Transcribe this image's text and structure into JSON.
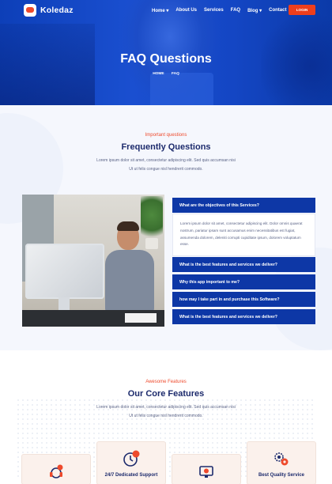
{
  "brand": {
    "name": "Koledaz"
  },
  "nav": {
    "items": [
      {
        "label": "Home",
        "dropdown": true
      },
      {
        "label": "About Us",
        "dropdown": false
      },
      {
        "label": "Services",
        "dropdown": false
      },
      {
        "label": "FAQ",
        "dropdown": false
      },
      {
        "label": "Blog",
        "dropdown": true
      },
      {
        "label": "Contact",
        "dropdown": false
      }
    ],
    "login_label": "LOGIN"
  },
  "hero": {
    "title": "FAQ Questions",
    "breadcrumb": [
      "HOME",
      "FAQ"
    ]
  },
  "faq_section": {
    "eyebrow": "Important questions",
    "title": "Frequently Questions",
    "intro": "Lorem ipsum dolor sit amet, consectetur adipiscing elit. Sed quis accumsan nisi Ut ut felis congue nisl hendrerit commodo.",
    "items": [
      {
        "question": "What are the objectives of this Services?",
        "expanded": true,
        "answer": "Lorem ipsum dolor sit amet, consectetur adipiscing elit. Dolor omnis quaerat nostrum, pariatur ipsam sunt accusamus enim necessitatibus est fugiat, assumenda dolorem, deleniti corrupti cupiditate ipsum, dolorem voluptatum esse."
      },
      {
        "question": "What is the best features and services we deliver?",
        "expanded": false
      },
      {
        "question": "Why this app important to me?",
        "expanded": false
      },
      {
        "question": "how may I take part in and purchase this Software?",
        "expanded": false
      },
      {
        "question": "What is the best features and services we deliver?",
        "expanded": false
      }
    ]
  },
  "features_section": {
    "eyebrow": "Awesome Features",
    "title": "Our Core Features",
    "intro": "Lorem ipsum dolor sit amet, consectetur adipiscing elit. Sed quis accumsan nisi Ut ut felis congue nisl hendrerit commodo.",
    "cards": [
      {
        "label": "",
        "icon": "support-headset-icon"
      },
      {
        "label": "24/7 Dedicated Support",
        "icon": "clock-24-icon"
      },
      {
        "label": "",
        "icon": "monitor-settings-icon"
      },
      {
        "label": "Best Quality Service",
        "icon": "gears-icon"
      }
    ]
  },
  "colors": {
    "primary": "#0d37a6",
    "accent": "#ee4a2c",
    "heading": "#1c2a6c"
  }
}
